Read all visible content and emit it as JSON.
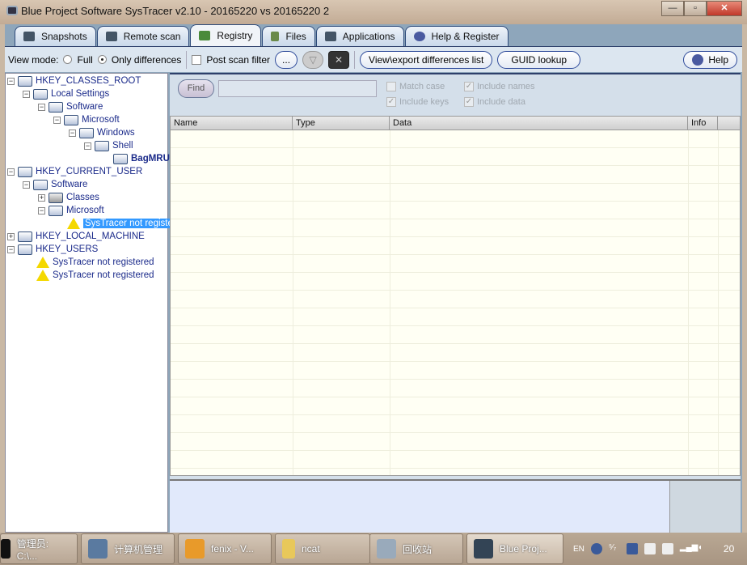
{
  "window": {
    "title": "Blue Project Software SysTracer v2.10 - 20165220 vs 20165220  2",
    "minimize": "—",
    "maximize": "▫",
    "close": "✕"
  },
  "tabs": [
    {
      "label": "Snapshots",
      "icon": "camera-icon"
    },
    {
      "label": "Remote scan",
      "icon": "network-icon"
    },
    {
      "label": "Registry",
      "icon": "registry-icon",
      "active": true
    },
    {
      "label": "Files",
      "icon": "files-icon"
    },
    {
      "label": "Applications",
      "icon": "applications-icon"
    },
    {
      "label": "Help & Register",
      "icon": "help-icon"
    }
  ],
  "toolbar": {
    "view_mode_label": "View mode:",
    "full": "Full",
    "only_differences": "Only differences",
    "selected": "Only differences",
    "post_scan_filter": "Post scan filter",
    "post_scan_filter_checked": false,
    "ellipsis": "...",
    "view_export": "View\\export differences list",
    "guid_lookup": "GUID lookup",
    "help": "Help"
  },
  "tree": [
    {
      "label": "HKEY_CLASSES_ROOT",
      "level": 0,
      "exp": "−",
      "type": "folder"
    },
    {
      "label": "Local Settings",
      "level": 1,
      "exp": "−",
      "type": "folder"
    },
    {
      "label": "Software",
      "level": 2,
      "exp": "−",
      "type": "folder"
    },
    {
      "label": "Microsoft",
      "level": 3,
      "exp": "−",
      "type": "folder"
    },
    {
      "label": "Windows",
      "level": 4,
      "exp": "−",
      "type": "folder"
    },
    {
      "label": "Shell",
      "level": 5,
      "exp": "−",
      "type": "folder"
    },
    {
      "label": "BagMRU",
      "level": 6,
      "exp": "",
      "type": "folder",
      "bold": true
    },
    {
      "label": "HKEY_CURRENT_USER",
      "level": 0,
      "exp": "−",
      "type": "folder"
    },
    {
      "label": "Software",
      "level": 1,
      "exp": "−",
      "type": "folder"
    },
    {
      "label": "Classes",
      "level": 2,
      "exp": "+",
      "type": "link"
    },
    {
      "label": "Microsoft",
      "level": 2,
      "exp": "−",
      "type": "folder"
    },
    {
      "label": "SysTracer not registe",
      "level": 3,
      "exp": "",
      "type": "warning",
      "selected": true
    },
    {
      "label": "HKEY_LOCAL_MACHINE",
      "level": 0,
      "exp": "+",
      "type": "folder"
    },
    {
      "label": "HKEY_USERS",
      "level": 0,
      "exp": "−",
      "type": "folder"
    },
    {
      "label": "SysTracer not registered",
      "level": 1,
      "exp": "",
      "type": "warning"
    },
    {
      "label": "SysTracer not registered",
      "level": 1,
      "exp": "",
      "type": "warning"
    }
  ],
  "find": {
    "button": "Find",
    "value": "",
    "match_case": "Match case",
    "match_case_checked": false,
    "include_names": "Include names",
    "include_names_checked": true,
    "include_keys": "Include keys",
    "include_keys_checked": true,
    "include_data": "Include data",
    "include_data_checked": true
  },
  "table": {
    "columns": [
      "Name",
      "Type",
      "Data",
      "Info"
    ],
    "rows": []
  },
  "taskbar": {
    "items": [
      "管理员: C:\\...",
      "计算机管理",
      "fenix - V...",
      "ncat",
      "回收站",
      "Blue Proj..."
    ],
    "tray": {
      "lang": "EN",
      "clock_partial": "20"
    }
  }
}
